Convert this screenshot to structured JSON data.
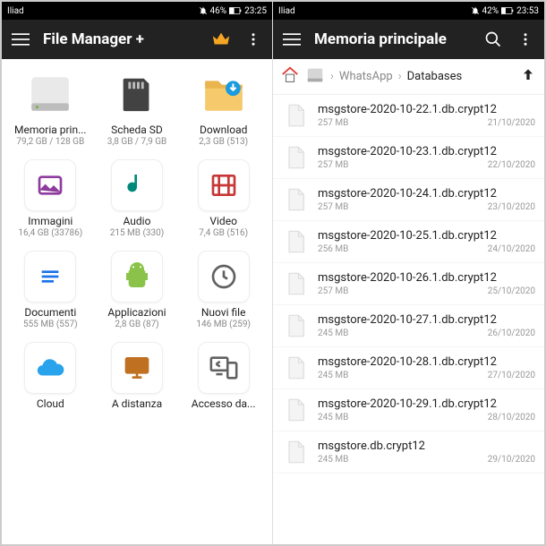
{
  "left": {
    "status": {
      "carrier": "Iliad",
      "battery": "46%",
      "time": "23:25"
    },
    "toolbar": {
      "title": "File Manager +"
    },
    "grid": [
      {
        "label": "Memoria prin...",
        "sub": "79,2 GB / 128 GB"
      },
      {
        "label": "Scheda SD",
        "sub": "3,8 GB / 7,9 GB"
      },
      {
        "label": "Download",
        "sub": "2,3 GB (513)"
      },
      {
        "label": "Immagini",
        "sub": "16,4 GB (33786)"
      },
      {
        "label": "Audio",
        "sub": "215 MB (330)"
      },
      {
        "label": "Video",
        "sub": "7,4 GB (516)"
      },
      {
        "label": "Documenti",
        "sub": "555 MB (557)"
      },
      {
        "label": "Applicazioni",
        "sub": "2,8 GB (87)"
      },
      {
        "label": "Nuovi file",
        "sub": "146 MB (259)"
      },
      {
        "label": "Cloud",
        "sub": ""
      },
      {
        "label": "A distanza",
        "sub": ""
      },
      {
        "label": "Accesso da...",
        "sub": ""
      }
    ]
  },
  "right": {
    "status": {
      "carrier": "Iliad",
      "battery": "42%",
      "time": "23:53"
    },
    "toolbar": {
      "title": "Memoria principale"
    },
    "breadcrumb": {
      "mid": "WhatsApp",
      "last": "Databases"
    },
    "files": [
      {
        "name": "msgstore-2020-10-22.1.db.crypt12",
        "size": "257 MB",
        "date": "21/10/2020"
      },
      {
        "name": "msgstore-2020-10-23.1.db.crypt12",
        "size": "257 MB",
        "date": "22/10/2020"
      },
      {
        "name": "msgstore-2020-10-24.1.db.crypt12",
        "size": "257 MB",
        "date": "23/10/2020"
      },
      {
        "name": "msgstore-2020-10-25.1.db.crypt12",
        "size": "256 MB",
        "date": "24/10/2020"
      },
      {
        "name": "msgstore-2020-10-26.1.db.crypt12",
        "size": "257 MB",
        "date": "25/10/2020"
      },
      {
        "name": "msgstore-2020-10-27.1.db.crypt12",
        "size": "245 MB",
        "date": "26/10/2020"
      },
      {
        "name": "msgstore-2020-10-28.1.db.crypt12",
        "size": "245 MB",
        "date": "27/10/2020"
      },
      {
        "name": "msgstore-2020-10-29.1.db.crypt12",
        "size": "245 MB",
        "date": "28/10/2020"
      },
      {
        "name": "msgstore.db.crypt12",
        "size": "245 MB",
        "date": "29/10/2020"
      }
    ]
  }
}
